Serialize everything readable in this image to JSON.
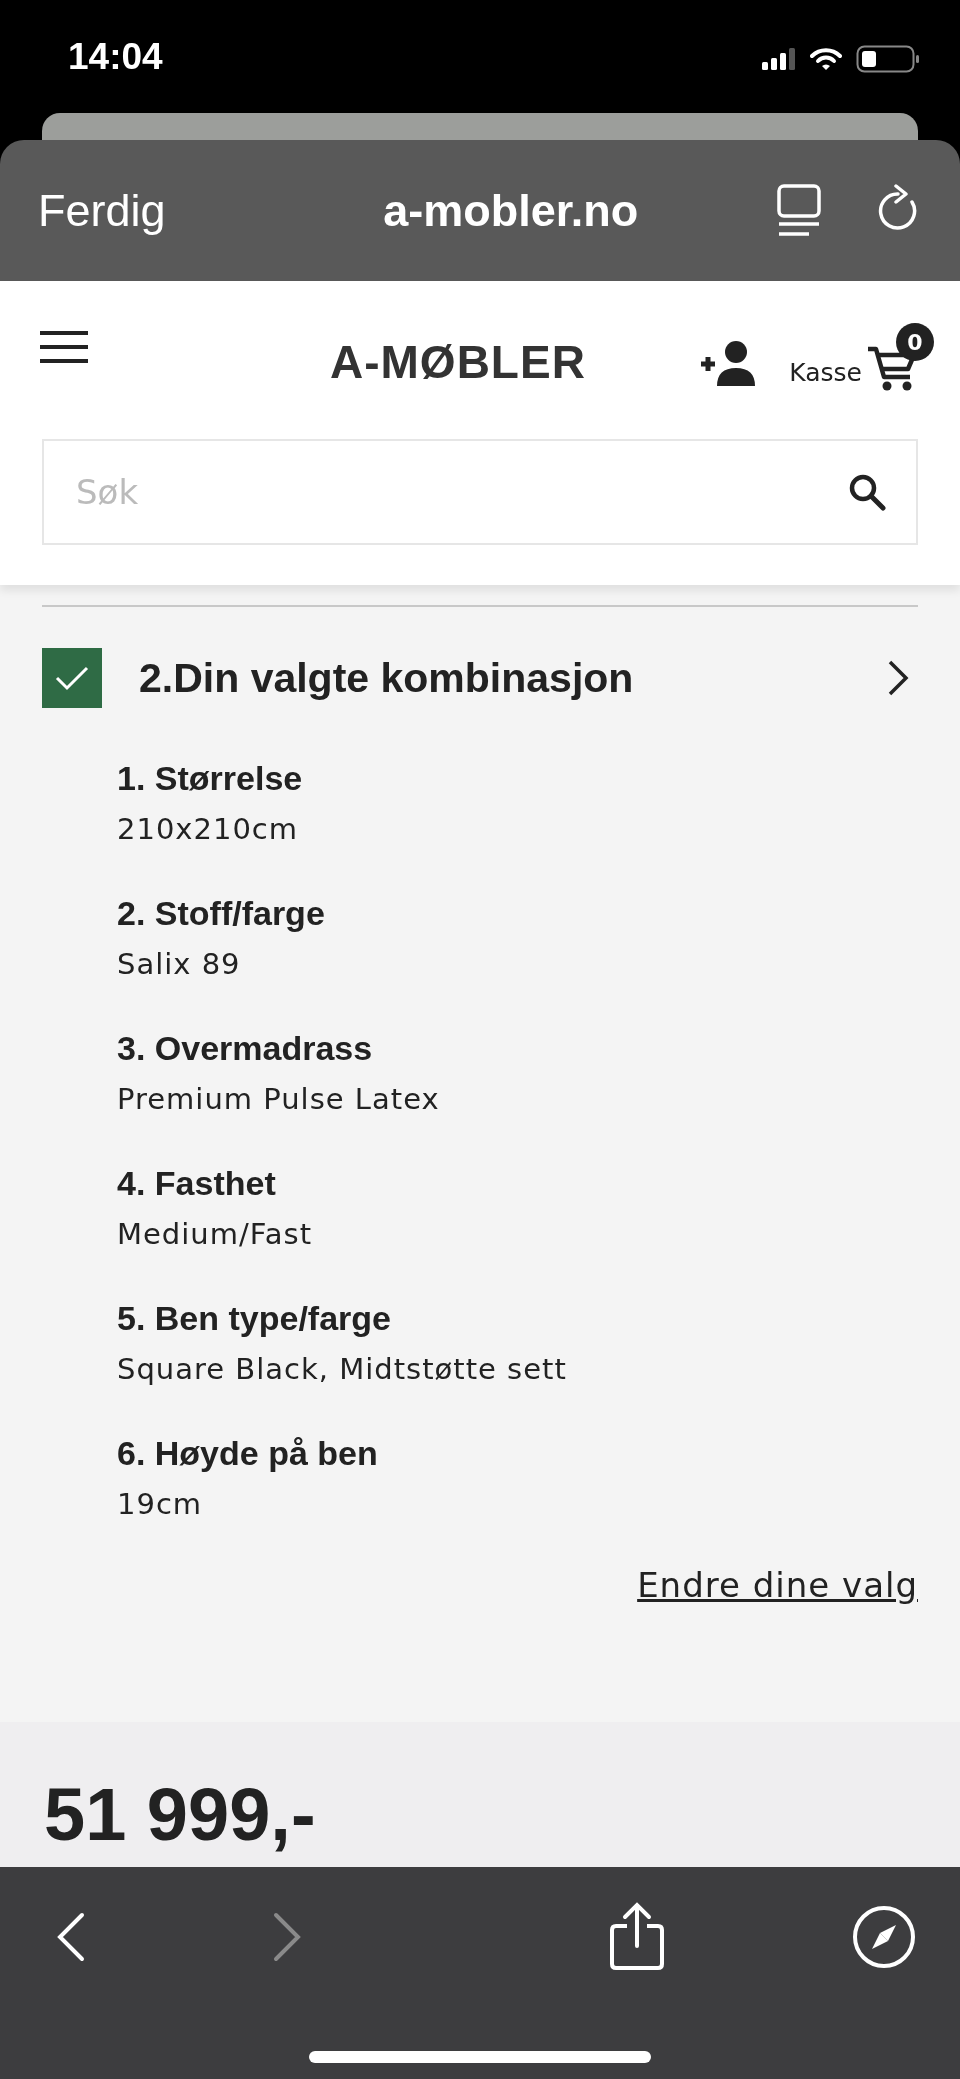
{
  "status_bar": {
    "time": "14:04"
  },
  "browser_bar": {
    "done_label": "Ferdig",
    "address": "a-mobler.no"
  },
  "header": {
    "logo": "A-MØBLER",
    "cart_label": "Kasse",
    "cart_count": "0"
  },
  "search": {
    "placeholder": "Søk"
  },
  "step": {
    "title": "2.Din valgte kombinasjon",
    "checked": true
  },
  "choices": [
    {
      "title": "1. Størrelse",
      "value": "210x210cm"
    },
    {
      "title": "2. Stoff/farge",
      "value": "Salix 89"
    },
    {
      "title": "3. Overmadrass",
      "value": "Premium Pulse Latex"
    },
    {
      "title": "4. Fasthet",
      "value": "Medium/Fast"
    },
    {
      "title": "5. Ben type/farge",
      "value": "Square Black, Midtstøtte sett"
    },
    {
      "title": "6. Høyde på ben",
      "value": "19cm"
    }
  ],
  "change_link": "Endre dine valg",
  "price": "51 999,-",
  "toolbar": {
    "back_disabled": false,
    "forward_disabled": true
  }
}
